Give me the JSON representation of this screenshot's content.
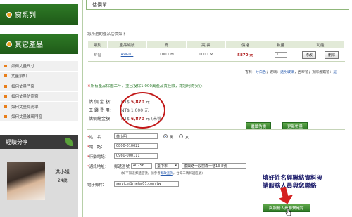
{
  "sidebar": {
    "cat1": "窗系列",
    "cat2": "其它產品",
    "sub_items": [
      "如何丈量尺寸",
      "丈量須知",
      "如何丈量門窗",
      "如何丈量防盜窗",
      "如何丈量採光罩",
      "如何丈量玻璃門窗"
    ],
    "experience_title": "經驗分享",
    "person_name": "洪小姐",
    "person_age": "24歲"
  },
  "main": {
    "tab_title": "估價單",
    "intro": "您所選的產品估價如下：",
    "columns": [
      "類別",
      "產品編號",
      "寬",
      "高/長",
      "價格",
      "數量",
      "功能"
    ],
    "row": {
      "category": "紗窗",
      "code": "AW-01",
      "width": "100 CM",
      "height": "100 CM",
      "price": "5870 元",
      "qty": "1",
      "edit": "修改",
      "delete": "刪除"
    },
    "spec": {
      "prefix": "香料：",
      "c1": "牙白色",
      "s1": "；玻璃：",
      "c2": "透明玻璃",
      "s2": "，含紗窗",
      "s3": "；拆除舊鐵窗：",
      "c3": "是"
    },
    "notice": {
      "star": "※",
      "text": "所有產品保固二年，並已投保1,000萬產品責任險，讓您用得安心"
    },
    "fees": [
      {
        "label": "估 價 金 額：",
        "prefix": "NT$ ",
        "amount": "5,870",
        "suffix": " 元"
      },
      {
        "label": "工 錢 費 用：",
        "prefix": "NT$ ",
        "amount": "1,000",
        "suffix": " 元"
      },
      {
        "label": "估價總金額：",
        "prefix": "NT$ ",
        "amount": "6,870",
        "suffix": " 元 (未稅)"
      }
    ],
    "btn_continue": "繼續估價",
    "btn_update": "更新數量",
    "form": {
      "name_label": "姓　名：",
      "name_value": "林小明",
      "male": "男",
      "female": "女",
      "phone_label": "電　話：",
      "phone_value": "0800-010022",
      "mobile_label": "行動電話：",
      "mobile_value": "0960-000111",
      "addr_label": "通訊地址：",
      "zip_label": "郵遞區號",
      "zip_value": "40256",
      "city_value": "臺中市",
      "addr_value": "復興路一段樹森一巷13-8號",
      "zip_note_a": "(如不知道郵遞區號，請參考",
      "zip_note_link": "郵政查詢",
      "zip_note_b": "，台灣三碼郵遞區號)",
      "email_label": "電子郵件：",
      "email_value": "service@metal01.com.tw"
    },
    "annotation": [
      "填好姓名與聯絡資料後",
      "請服務人員與您聯絡"
    ],
    "submit": "與服務人員聯繫確認"
  },
  "colors": {
    "green": "#2e7a26",
    "orange": "#e87e1a",
    "red_circle": "#c21818"
  }
}
